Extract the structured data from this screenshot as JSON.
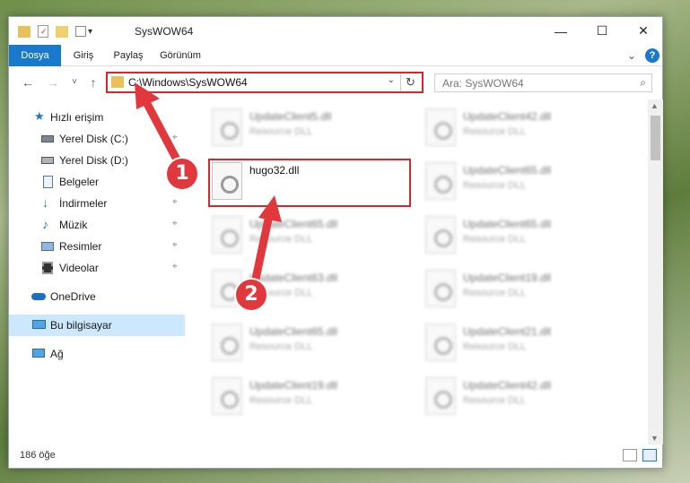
{
  "window": {
    "title": "SysWOW64",
    "quick_access_dropdown": "▾",
    "minimize": "—",
    "maximize": "☐",
    "close": "✕"
  },
  "ribbon": {
    "tabs": [
      "Dosya",
      "Giriş",
      "Paylaş",
      "Görünüm"
    ],
    "expand_icon": "⌄",
    "help_icon": "?"
  },
  "address": {
    "path": "C:\\Windows\\SysWOW64",
    "back": "←",
    "forward": "→",
    "recent": "˅",
    "up": "↑",
    "dropdown": "⌄",
    "refresh": "↻"
  },
  "search": {
    "placeholder": "Ara: SysWOW64",
    "icon": "⌕"
  },
  "sidebar": {
    "items": [
      {
        "label": "Hızlı erişim",
        "icon": "star-icon",
        "pinned": false
      },
      {
        "label": "Yerel Disk (C:)",
        "icon": "drive-icon",
        "pinned": true
      },
      {
        "label": "Yerel Disk (D:)",
        "icon": "drive-icon",
        "pinned": false
      },
      {
        "label": "Belgeler",
        "icon": "documents-icon",
        "pinned": true
      },
      {
        "label": "İndirmeler",
        "icon": "download-icon",
        "pinned": true
      },
      {
        "label": "Müzik",
        "icon": "music-icon",
        "pinned": true
      },
      {
        "label": "Resimler",
        "icon": "pictures-icon",
        "pinned": true
      },
      {
        "label": "Videolar",
        "icon": "videos-icon",
        "pinned": true
      },
      {
        "label": "OneDrive",
        "icon": "cloud-icon",
        "pinned": false
      },
      {
        "label": "Bu bilgisayar",
        "icon": "computer-icon",
        "pinned": false,
        "selected": true
      },
      {
        "label": "Ağ",
        "icon": "network-icon",
        "pinned": false
      }
    ],
    "pin_glyph": "⌖"
  },
  "files": {
    "highlighted": {
      "name": "hugo32.dll"
    },
    "left_column": [
      {
        "name": "UpdateClient5.dll",
        "type": "Resource DLL"
      },
      {
        "name": "UpdateClient65.dll",
        "type": "Resource DLL"
      },
      {
        "name": "UpdateClient63.dll",
        "type": "Resource DLL"
      },
      {
        "name": "UpdateClient65.dll",
        "type": "Resource DLL"
      },
      {
        "name": "UpdateClient19.dll",
        "type": "Resource DLL"
      }
    ],
    "right_column": [
      {
        "name": "UpdateClient42.dll",
        "type": "Resource DLL"
      },
      {
        "name": "UpdateClient65.dll",
        "type": "Resource DLL"
      },
      {
        "name": "UpdateClient65.dll",
        "type": "Resource DLL"
      },
      {
        "name": "UpdateClient19.dll",
        "type": "Resource DLL"
      },
      {
        "name": "UpdateClient21.dll",
        "type": "Resource DLL"
      },
      {
        "name": "UpdateClient42.dll",
        "type": "Resource DLL"
      }
    ]
  },
  "status": {
    "count": "186 öğe"
  },
  "annotations": {
    "step1": "1",
    "step2": "2",
    "color": "#e0383c"
  }
}
